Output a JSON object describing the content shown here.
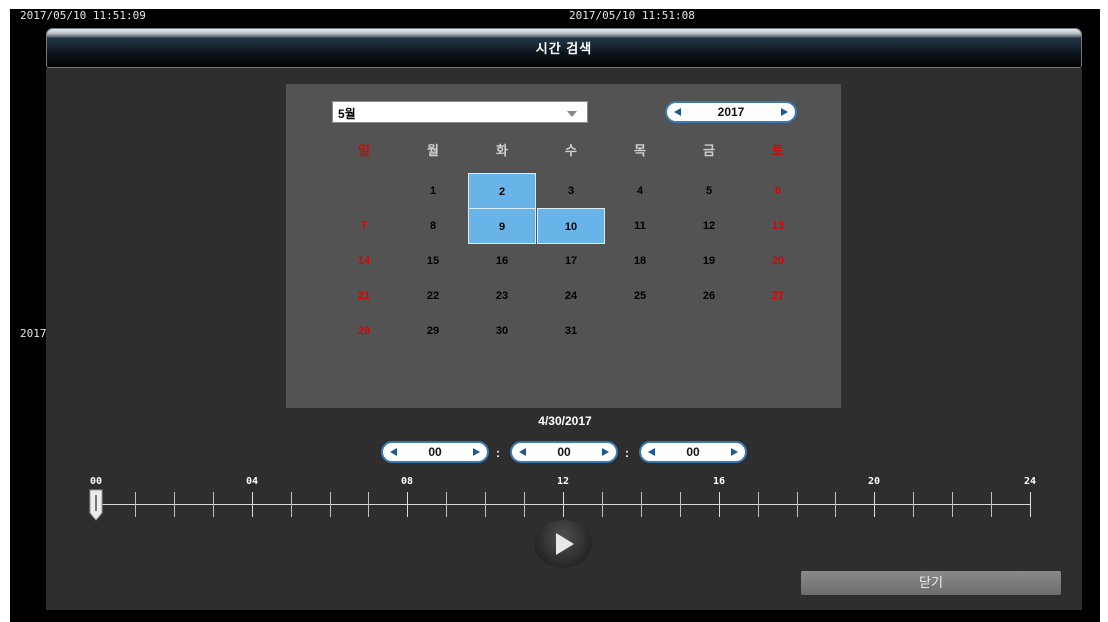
{
  "timestamps": {
    "left": "2017/05/10 11:51:09",
    "center": "2017/05/10 11:51:08"
  },
  "side_year": "2017",
  "window_title": "시간 검색",
  "calendar": {
    "month_select": {
      "value": "5월",
      "icon": "chevron-down-icon"
    },
    "year_spinner": {
      "value": "2017"
    },
    "weekdays": [
      "일",
      "월",
      "화",
      "수",
      "목",
      "금",
      "토"
    ],
    "weeks": [
      [
        "",
        "1",
        "2",
        "3",
        "4",
        "5",
        "6"
      ],
      [
        "7",
        "8",
        "9",
        "10",
        "11",
        "12",
        "13"
      ],
      [
        "14",
        "15",
        "16",
        "17",
        "18",
        "19",
        "20"
      ],
      [
        "21",
        "22",
        "23",
        "24",
        "25",
        "26",
        "27"
      ],
      [
        "28",
        "29",
        "30",
        "31",
        "",
        "",
        ""
      ]
    ],
    "highlighted_days": [
      "2",
      "9",
      "10"
    ],
    "colors": {
      "weekend": "#e00000",
      "weekday_header": "#cfcfcf",
      "highlight": "#68b3e8"
    }
  },
  "selected_date": "4/30/2017",
  "time_spinners": [
    {
      "name": "hour",
      "value": "00"
    },
    {
      "name": "minute",
      "value": "00"
    },
    {
      "name": "second",
      "value": "00"
    }
  ],
  "time_separator": ":",
  "timeline": {
    "labels": [
      "00",
      "04",
      "08",
      "12",
      "16",
      "20",
      "24"
    ],
    "hours": 24,
    "position_hours": 0
  },
  "play_button": {
    "icon": "play-icon"
  },
  "close_button": {
    "label": "닫기"
  }
}
